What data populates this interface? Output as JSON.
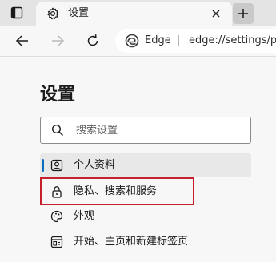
{
  "tab": {
    "title": "设置"
  },
  "omnibox": {
    "site_label": "Edge",
    "url": "edge://settings/p"
  },
  "settings": {
    "title": "设置",
    "search": {
      "placeholder": "搜索设置",
      "value": ""
    },
    "nav_items": [
      {
        "label": "个人资料",
        "icon": "profile-icon",
        "active": true
      },
      {
        "label": "隐私、搜索和服务",
        "icon": "lock-icon",
        "active": false,
        "highlighted": true
      },
      {
        "label": "外观",
        "icon": "palette-icon",
        "active": false
      },
      {
        "label": "开始、主页和新建标签页",
        "icon": "home-tab-icon",
        "active": false
      }
    ]
  },
  "colors": {
    "accent": "#0f6cbd",
    "highlight_border": "#c6202c",
    "tabstrip_bg": "#e4e4e4",
    "page_bg": "#f7f7f7"
  }
}
